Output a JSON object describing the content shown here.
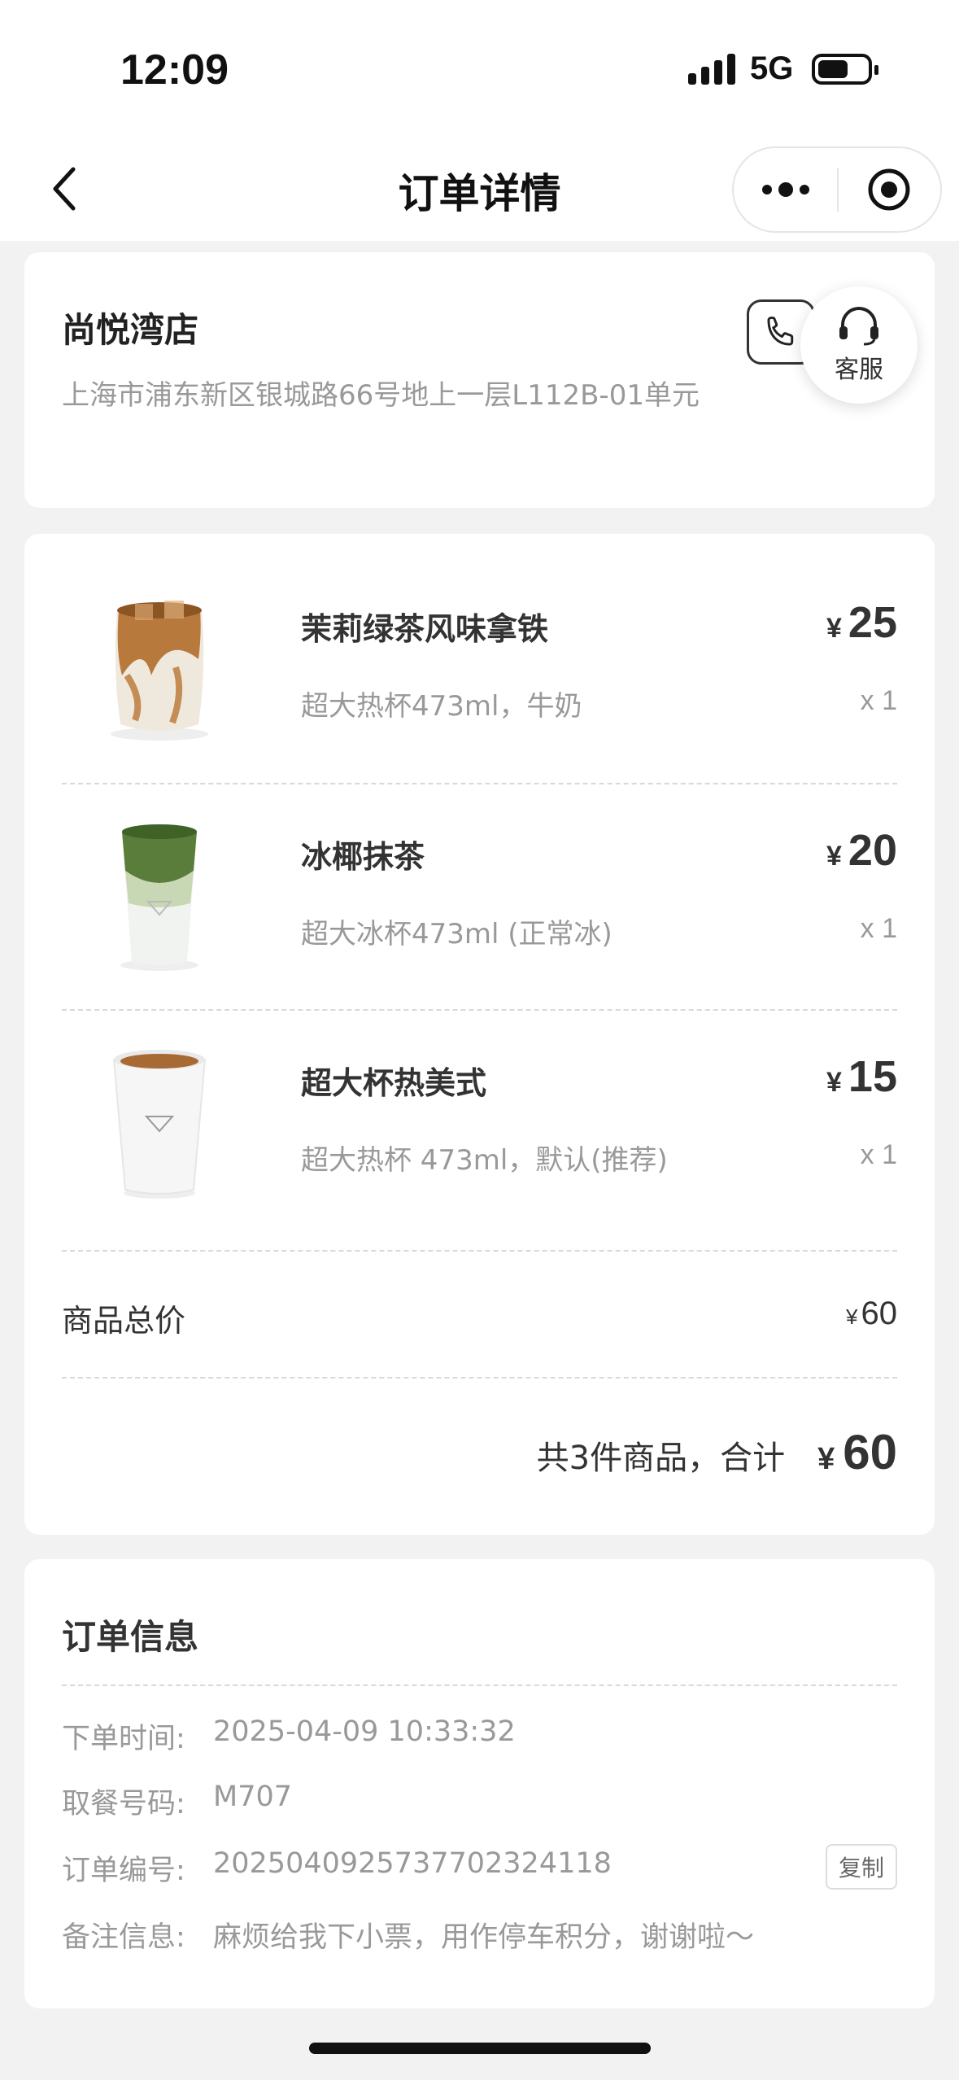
{
  "status_bar": {
    "time": "12:09",
    "network": "5G"
  },
  "nav": {
    "title": "订单详情"
  },
  "store": {
    "name": "尚悦湾店",
    "address": "上海市浦东新区银城路66号地上一层L112B-01单元",
    "service_label": "客服"
  },
  "currency": "¥",
  "items": [
    {
      "name": "茉莉绿茶风味拿铁",
      "spec": "超大热杯473ml，牛奶",
      "price": "25",
      "qty": "x 1",
      "image": "iced-latte-image"
    },
    {
      "name": "冰椰抹茶",
      "spec": "超大冰杯473ml (正常冰)",
      "price": "20",
      "qty": "x 1",
      "image": "matcha-drink-image"
    },
    {
      "name": "超大杯热美式",
      "spec": "超大热杯 473ml，默认(推荐)",
      "price": "15",
      "qty": "x 1",
      "image": "hot-americano-image"
    }
  ],
  "summary": {
    "subtotal_label": "商品总价",
    "subtotal_value": "60",
    "total_text": "共3件商品，合计",
    "total_value": "60"
  },
  "order_info": {
    "title": "订单信息",
    "rows": [
      {
        "key": "下单时间:",
        "value": "2025-04-09 10:33:32"
      },
      {
        "key": "取餐号码:",
        "value": "M707"
      },
      {
        "key": "订单编号:",
        "value": "2025040925737702324118"
      },
      {
        "key": "备注信息:",
        "value": "麻烦给我下小票，用作停车积分，谢谢啦～"
      }
    ],
    "copy_label": "复制"
  }
}
